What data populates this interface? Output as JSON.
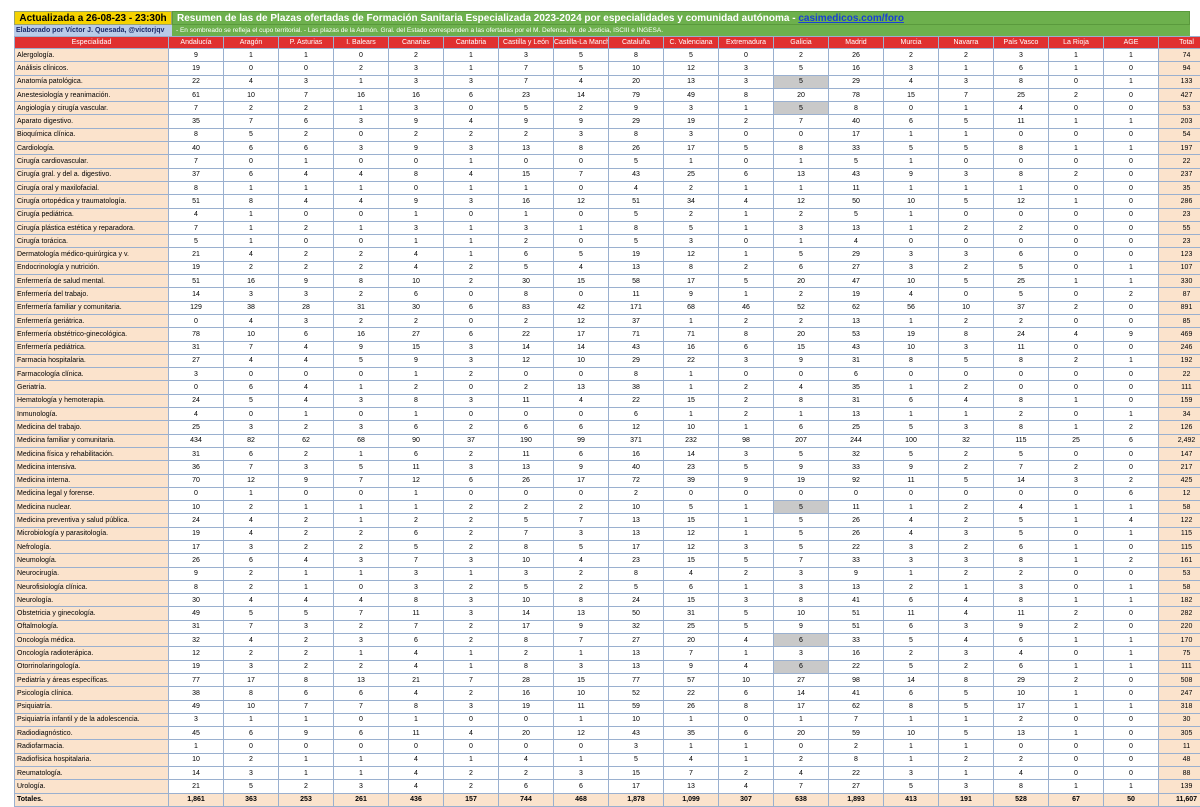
{
  "header": {
    "updated": "Actualizada a 26-08-23 - 23:30h",
    "title": "Resumen de las de Plazas ofertadas de Formación Sanitaria Especializada 2023-2024 por especialidades y comunidad autónoma - ",
    "link": "casimedicos.com/foro",
    "author": "Elaborado por Víctor J. Quesada, @victorjqv",
    "note": "- En sombreado se refleja el cupo territorial. - Las plazas de la Admón. Gral. del Estado corresponden a las ofertadas por el M. Defensa, M. de Justicia, ISCIII e INGESA."
  },
  "columns": [
    "Especialidad",
    "Andalucía",
    "Aragón",
    "P. Asturias",
    "I. Balears",
    "Canarias",
    "Cantabria",
    "Castilla y León",
    "Castilla-La Mancha",
    "Cataluña",
    "C. Valenciana",
    "Extremadura",
    "Galicia",
    "Madrid",
    "Murcia",
    "Navarra",
    "País Vasco",
    "La Rioja",
    "AGE",
    "Total"
  ],
  "rows": [
    [
      "Alergología.",
      "9",
      "1",
      "1",
      "0",
      "2",
      "1",
      "3",
      "5",
      "8",
      "5",
      "0",
      "2",
      "26",
      "2",
      "2",
      "3",
      "1",
      "1",
      "74"
    ],
    [
      "Análisis clínicos.",
      "19",
      "0",
      "0",
      "2",
      "3",
      "1",
      "7",
      "5",
      "10",
      "12",
      "3",
      "5",
      "16",
      "3",
      "1",
      "6",
      "1",
      "0",
      "94"
    ],
    [
      "Anatomía patológica.",
      "22",
      "4",
      "3",
      "1",
      "3",
      "3",
      "7",
      "4",
      "20",
      "13",
      "3",
      "5",
      "29",
      "4",
      "3",
      "8",
      "0",
      "1",
      "133"
    ],
    [
      "Anestesiología y reanimación.",
      "61",
      "10",
      "7",
      "16",
      "16",
      "6",
      "23",
      "14",
      "79",
      "49",
      "8",
      "20",
      "78",
      "15",
      "7",
      "25",
      "2",
      "0",
      "427"
    ],
    [
      "Angiología y cirugía vascular.",
      "7",
      "2",
      "2",
      "1",
      "3",
      "0",
      "5",
      "2",
      "9",
      "3",
      "1",
      "5",
      "8",
      "0",
      "1",
      "4",
      "0",
      "0",
      "53"
    ],
    [
      "Aparato digestivo.",
      "35",
      "7",
      "6",
      "3",
      "9",
      "4",
      "9",
      "9",
      "29",
      "19",
      "2",
      "7",
      "40",
      "6",
      "5",
      "11",
      "1",
      "1",
      "203"
    ],
    [
      "Bioquímica clínica.",
      "8",
      "5",
      "2",
      "0",
      "2",
      "2",
      "2",
      "3",
      "8",
      "3",
      "0",
      "0",
      "17",
      "1",
      "1",
      "0",
      "0",
      "0",
      "54"
    ],
    [
      "Cardiología.",
      "40",
      "6",
      "6",
      "3",
      "9",
      "3",
      "13",
      "8",
      "26",
      "17",
      "5",
      "8",
      "33",
      "5",
      "5",
      "8",
      "1",
      "1",
      "197"
    ],
    [
      "Cirugía cardiovascular.",
      "7",
      "0",
      "1",
      "0",
      "0",
      "1",
      "0",
      "0",
      "5",
      "1",
      "0",
      "1",
      "5",
      "1",
      "0",
      "0",
      "0",
      "0",
      "22"
    ],
    [
      "Cirugía gral. y del a. digestivo.",
      "37",
      "6",
      "4",
      "4",
      "8",
      "4",
      "15",
      "7",
      "43",
      "25",
      "6",
      "13",
      "43",
      "9",
      "3",
      "8",
      "2",
      "0",
      "237"
    ],
    [
      "Cirugía oral y maxilofacial.",
      "8",
      "1",
      "1",
      "1",
      "0",
      "1",
      "1",
      "0",
      "4",
      "2",
      "1",
      "1",
      "11",
      "1",
      "1",
      "1",
      "0",
      "0",
      "35"
    ],
    [
      "Cirugía ortopédica y traumatología.",
      "51",
      "8",
      "4",
      "4",
      "9",
      "3",
      "16",
      "12",
      "51",
      "34",
      "4",
      "12",
      "50",
      "10",
      "5",
      "12",
      "1",
      "0",
      "286"
    ],
    [
      "Cirugía pediátrica.",
      "4",
      "1",
      "0",
      "0",
      "1",
      "0",
      "1",
      "0",
      "5",
      "2",
      "1",
      "2",
      "5",
      "1",
      "0",
      "0",
      "0",
      "0",
      "23"
    ],
    [
      "Cirugía plástica estética y reparadora.",
      "7",
      "1",
      "2",
      "1",
      "3",
      "1",
      "3",
      "1",
      "8",
      "5",
      "1",
      "3",
      "13",
      "1",
      "2",
      "2",
      "0",
      "0",
      "55"
    ],
    [
      "Cirugía torácica.",
      "5",
      "1",
      "0",
      "0",
      "1",
      "1",
      "2",
      "0",
      "5",
      "3",
      "0",
      "1",
      "4",
      "0",
      "0",
      "0",
      "0",
      "0",
      "23"
    ],
    [
      "Dermatología médico-quirúrgica y v.",
      "21",
      "4",
      "2",
      "2",
      "4",
      "1",
      "6",
      "5",
      "19",
      "12",
      "1",
      "5",
      "29",
      "3",
      "3",
      "6",
      "0",
      "0",
      "123"
    ],
    [
      "Endocrinología y nutrición.",
      "19",
      "2",
      "2",
      "2",
      "4",
      "2",
      "5",
      "4",
      "13",
      "8",
      "2",
      "6",
      "27",
      "3",
      "2",
      "5",
      "0",
      "1",
      "107"
    ],
    [
      "Enfermería de salud mental.",
      "51",
      "16",
      "9",
      "8",
      "10",
      "2",
      "30",
      "15",
      "58",
      "17",
      "5",
      "20",
      "47",
      "10",
      "5",
      "25",
      "1",
      "1",
      "330"
    ],
    [
      "Enfermería del trabajo.",
      "14",
      "3",
      "3",
      "2",
      "6",
      "0",
      "8",
      "0",
      "11",
      "9",
      "1",
      "2",
      "19",
      "4",
      "0",
      "5",
      "0",
      "2",
      "87"
    ],
    [
      "Enfermería familiar y comunitaria.",
      "129",
      "38",
      "28",
      "31",
      "30",
      "6",
      "83",
      "42",
      "171",
      "68",
      "46",
      "52",
      "62",
      "56",
      "10",
      "37",
      "2",
      "0",
      "891"
    ],
    [
      "Enfermería geriátrica.",
      "0",
      "4",
      "3",
      "2",
      "2",
      "0",
      "2",
      "12",
      "37",
      "1",
      "2",
      "2",
      "13",
      "1",
      "2",
      "2",
      "0",
      "0",
      "85"
    ],
    [
      "Enfermería obstétrico-ginecológica.",
      "78",
      "10",
      "6",
      "16",
      "27",
      "6",
      "22",
      "17",
      "71",
      "71",
      "8",
      "20",
      "53",
      "19",
      "8",
      "24",
      "4",
      "9",
      "469"
    ],
    [
      "Enfermería pediátrica.",
      "31",
      "7",
      "4",
      "9",
      "15",
      "3",
      "14",
      "14",
      "43",
      "16",
      "6",
      "15",
      "43",
      "10",
      "3",
      "11",
      "0",
      "0",
      "246"
    ],
    [
      "Farmacia hospitalaria.",
      "27",
      "4",
      "4",
      "5",
      "9",
      "3",
      "12",
      "10",
      "29",
      "22",
      "3",
      "9",
      "31",
      "8",
      "5",
      "8",
      "2",
      "1",
      "192"
    ],
    [
      "Farmacología clínica.",
      "3",
      "0",
      "0",
      "0",
      "1",
      "2",
      "0",
      "0",
      "8",
      "1",
      "0",
      "0",
      "6",
      "0",
      "0",
      "0",
      "0",
      "0",
      "22"
    ],
    [
      "Geriatría.",
      "0",
      "6",
      "4",
      "1",
      "2",
      "0",
      "2",
      "13",
      "38",
      "1",
      "2",
      "4",
      "35",
      "1",
      "2",
      "0",
      "0",
      "0",
      "111"
    ],
    [
      "Hematología y hemoterapia.",
      "24",
      "5",
      "4",
      "3",
      "8",
      "3",
      "11",
      "4",
      "22",
      "15",
      "2",
      "8",
      "31",
      "6",
      "4",
      "8",
      "1",
      "0",
      "159"
    ],
    [
      "Inmunología.",
      "4",
      "0",
      "1",
      "0",
      "1",
      "0",
      "0",
      "0",
      "6",
      "1",
      "2",
      "1",
      "13",
      "1",
      "1",
      "2",
      "0",
      "1",
      "34"
    ],
    [
      "Medicina del trabajo.",
      "25",
      "3",
      "2",
      "3",
      "6",
      "2",
      "6",
      "6",
      "12",
      "10",
      "1",
      "6",
      "25",
      "5",
      "3",
      "8",
      "1",
      "2",
      "126"
    ],
    [
      "Medicina familiar y comunitaria.",
      "434",
      "82",
      "62",
      "68",
      "90",
      "37",
      "190",
      "99",
      "371",
      "232",
      "98",
      "207",
      "244",
      "100",
      "32",
      "115",
      "25",
      "6",
      "2,492"
    ],
    [
      "Medicina física y rehabilitación.",
      "31",
      "6",
      "2",
      "1",
      "6",
      "2",
      "11",
      "6",
      "16",
      "14",
      "3",
      "5",
      "32",
      "5",
      "2",
      "5",
      "0",
      "0",
      "147"
    ],
    [
      "Medicina intensiva.",
      "36",
      "7",
      "3",
      "5",
      "11",
      "3",
      "13",
      "9",
      "40",
      "23",
      "5",
      "9",
      "33",
      "9",
      "2",
      "7",
      "2",
      "0",
      "217"
    ],
    [
      "Medicina interna.",
      "70",
      "12",
      "9",
      "7",
      "12",
      "6",
      "26",
      "17",
      "72",
      "39",
      "9",
      "19",
      "92",
      "11",
      "5",
      "14",
      "3",
      "2",
      "425"
    ],
    [
      "Medicina legal y forense.",
      "0",
      "1",
      "0",
      "0",
      "1",
      "0",
      "0",
      "0",
      "2",
      "0",
      "0",
      "0",
      "0",
      "0",
      "0",
      "0",
      "0",
      "6",
      "12"
    ],
    [
      "Medicina nuclear.",
      "10",
      "2",
      "1",
      "1",
      "1",
      "2",
      "2",
      "2",
      "10",
      "5",
      "1",
      "5",
      "11",
      "1",
      "2",
      "4",
      "1",
      "1",
      "58"
    ],
    [
      "Medicina preventiva y salud pública.",
      "24",
      "4",
      "2",
      "1",
      "2",
      "2",
      "5",
      "7",
      "13",
      "15",
      "1",
      "5",
      "26",
      "4",
      "2",
      "5",
      "1",
      "4",
      "122"
    ],
    [
      "Microbiología y parasitología.",
      "19",
      "4",
      "2",
      "2",
      "6",
      "2",
      "7",
      "3",
      "13",
      "12",
      "1",
      "5",
      "26",
      "4",
      "3",
      "5",
      "0",
      "1",
      "115"
    ],
    [
      "Nefrología.",
      "17",
      "3",
      "2",
      "2",
      "5",
      "2",
      "8",
      "5",
      "17",
      "12",
      "3",
      "5",
      "22",
      "3",
      "2",
      "6",
      "1",
      "0",
      "115"
    ],
    [
      "Neumología.",
      "26",
      "6",
      "4",
      "3",
      "7",
      "3",
      "10",
      "4",
      "23",
      "15",
      "5",
      "7",
      "33",
      "3",
      "3",
      "8",
      "1",
      "2",
      "161"
    ],
    [
      "Neurocirugía.",
      "9",
      "2",
      "1",
      "1",
      "3",
      "1",
      "3",
      "2",
      "8",
      "4",
      "2",
      "3",
      "9",
      "1",
      "2",
      "2",
      "0",
      "0",
      "53"
    ],
    [
      "Neurofisiología clínica.",
      "8",
      "2",
      "1",
      "0",
      "3",
      "2",
      "5",
      "2",
      "5",
      "6",
      "1",
      "3",
      "13",
      "2",
      "1",
      "3",
      "0",
      "1",
      "58"
    ],
    [
      "Neurología.",
      "30",
      "4",
      "4",
      "4",
      "8",
      "3",
      "10",
      "8",
      "24",
      "15",
      "3",
      "8",
      "41",
      "6",
      "4",
      "8",
      "1",
      "1",
      "182"
    ],
    [
      "Obstetricia y ginecología.",
      "49",
      "5",
      "5",
      "7",
      "11",
      "3",
      "14",
      "13",
      "50",
      "31",
      "5",
      "10",
      "51",
      "11",
      "4",
      "11",
      "2",
      "0",
      "282"
    ],
    [
      "Oftalmología.",
      "31",
      "7",
      "3",
      "2",
      "7",
      "2",
      "17",
      "9",
      "32",
      "25",
      "5",
      "9",
      "51",
      "6",
      "3",
      "9",
      "2",
      "0",
      "220"
    ],
    [
      "Oncología médica.",
      "32",
      "4",
      "2",
      "3",
      "6",
      "2",
      "8",
      "7",
      "27",
      "20",
      "4",
      "6",
      "33",
      "5",
      "4",
      "6",
      "1",
      "1",
      "170"
    ],
    [
      "Oncología radioterápica.",
      "12",
      "2",
      "2",
      "1",
      "4",
      "1",
      "2",
      "1",
      "13",
      "7",
      "1",
      "3",
      "16",
      "2",
      "3",
      "4",
      "0",
      "1",
      "75"
    ],
    [
      "Otorrinolaringología.",
      "19",
      "3",
      "2",
      "2",
      "4",
      "1",
      "8",
      "3",
      "13",
      "9",
      "4",
      "6",
      "22",
      "5",
      "2",
      "6",
      "1",
      "1",
      "111"
    ],
    [
      "Pediatría y áreas específicas.",
      "77",
      "17",
      "8",
      "13",
      "21",
      "7",
      "28",
      "15",
      "77",
      "57",
      "10",
      "27",
      "98",
      "14",
      "8",
      "29",
      "2",
      "0",
      "508"
    ],
    [
      "Psicología clínica.",
      "38",
      "8",
      "6",
      "6",
      "4",
      "2",
      "16",
      "10",
      "52",
      "22",
      "6",
      "14",
      "41",
      "6",
      "5",
      "10",
      "1",
      "0",
      "247"
    ],
    [
      "Psiquiatría.",
      "49",
      "10",
      "7",
      "7",
      "8",
      "3",
      "19",
      "11",
      "59",
      "26",
      "8",
      "17",
      "62",
      "8",
      "5",
      "17",
      "1",
      "1",
      "318"
    ],
    [
      "Psiquiatría infantil y de la adolescencia.",
      "3",
      "1",
      "1",
      "0",
      "1",
      "0",
      "0",
      "1",
      "10",
      "1",
      "0",
      "1",
      "7",
      "1",
      "1",
      "2",
      "0",
      "0",
      "30"
    ],
    [
      "Radiodiagnóstico.",
      "45",
      "6",
      "9",
      "6",
      "11",
      "4",
      "20",
      "12",
      "43",
      "35",
      "6",
      "20",
      "59",
      "10",
      "5",
      "13",
      "1",
      "0",
      "305"
    ],
    [
      "Radiofarmacia.",
      "1",
      "0",
      "0",
      "0",
      "0",
      "0",
      "0",
      "0",
      "3",
      "1",
      "1",
      "0",
      "2",
      "1",
      "1",
      "0",
      "0",
      "0",
      "11"
    ],
    [
      "Radiofísica hospitalaria.",
      "10",
      "2",
      "1",
      "1",
      "4",
      "1",
      "4",
      "1",
      "5",
      "4",
      "1",
      "2",
      "8",
      "1",
      "2",
      "2",
      "0",
      "0",
      "48"
    ],
    [
      "Reumatología.",
      "14",
      "3",
      "1",
      "1",
      "4",
      "2",
      "2",
      "3",
      "15",
      "7",
      "2",
      "4",
      "22",
      "3",
      "1",
      "4",
      "0",
      "0",
      "88"
    ],
    [
      "Urología.",
      "21",
      "5",
      "2",
      "3",
      "4",
      "2",
      "6",
      "6",
      "17",
      "13",
      "4",
      "7",
      "27",
      "5",
      "3",
      "8",
      "1",
      "1",
      "139"
    ]
  ],
  "totals": [
    "Totales.",
    "1,861",
    "363",
    "253",
    "261",
    "436",
    "157",
    "744",
    "468",
    "1,878",
    "1,099",
    "307",
    "638",
    "1,893",
    "413",
    "191",
    "528",
    "67",
    "50",
    "11,607"
  ],
  "shaded": [
    [
      2,
      12
    ],
    [
      4,
      12
    ],
    [
      34,
      12
    ],
    [
      44,
      12
    ],
    [
      46,
      12
    ]
  ]
}
